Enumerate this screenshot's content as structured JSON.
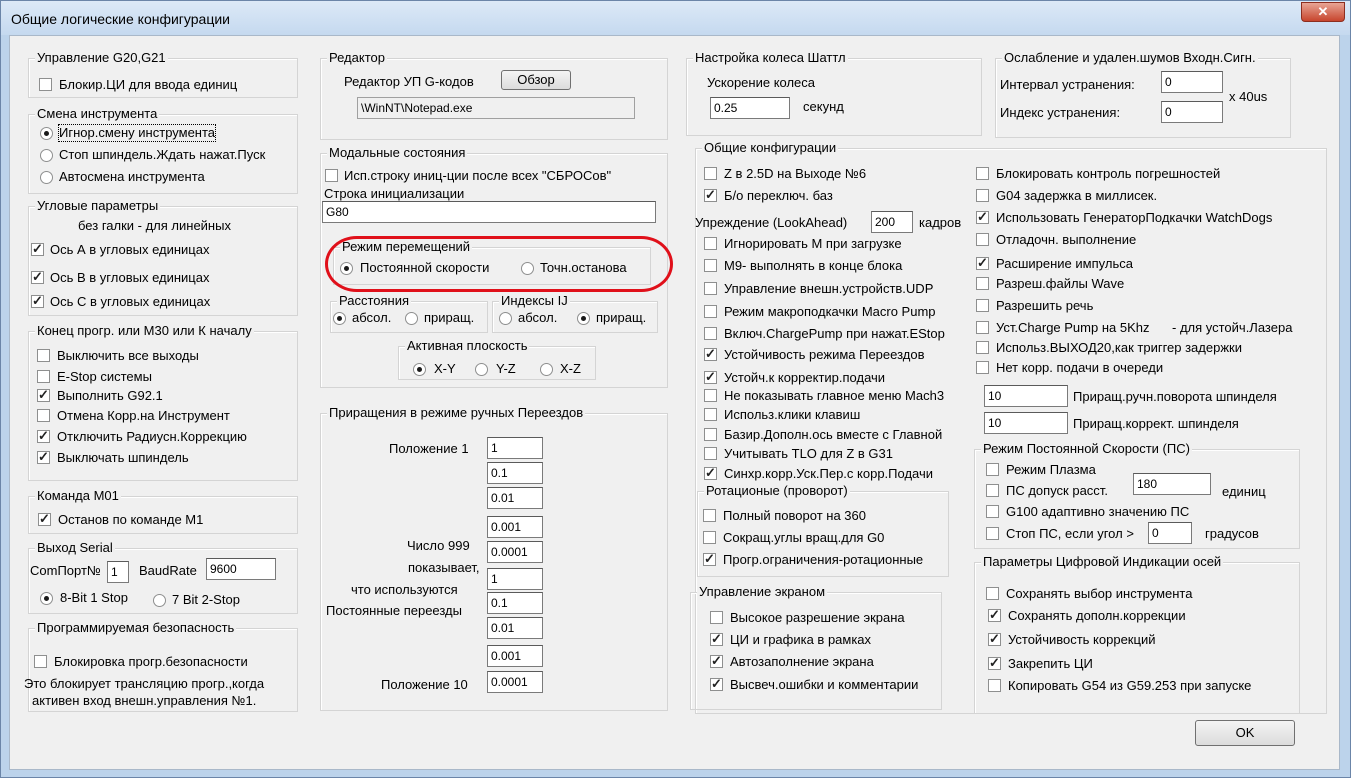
{
  "title": "Общие логические конфигурации",
  "close_label": "✕",
  "g20": {
    "title": "Управление G20,G21",
    "items": [
      "Блокир.ЦИ для ввода единиц"
    ]
  },
  "tool": {
    "title": "Смена инструмента",
    "items": [
      "Игнор.смену инструмента",
      "Стоп шпиндель.Ждать нажат.Пуск",
      "Автосмена инструмента"
    ]
  },
  "angular": {
    "title": "Угловые параметры",
    "subtitle": "без галки - для линейных",
    "items": [
      "Ось А в угловых единицах",
      "Ось B в угловых единицах",
      "Ось C в угловых единицах"
    ]
  },
  "endprog": {
    "title": "Конец прогр. или М30 или К началу",
    "items": [
      "Выключить все выходы",
      "E-Stop системы",
      "Выполнить G92.1",
      "Отмена Корр.на Инструмент",
      "Отключить Радиусн.Коррекцию",
      "Выключать шпиндель"
    ]
  },
  "m01": {
    "title": "Команда М01",
    "items": [
      "Останов по команде М1"
    ]
  },
  "serial": {
    "title": "Выход Serial",
    "port_label": "ComПорт№",
    "port_value": "1",
    "baud_label": "BaudRate",
    "baud_value": "9600",
    "opt1": "8-Bit 1 Stop",
    "opt2": "7 Bit 2-Stop"
  },
  "safety": {
    "title": "Программируемая безопасность",
    "item": "Блокировка прогр.безопасности",
    "note1": "Это блокирует трансляцию прогр.,когда",
    "note2": "активен вход внешн.управления №1."
  },
  "editor": {
    "title": "Редактор",
    "label": "Редактор УП G-кодов",
    "browse": "Обзор",
    "path": "\\WinNT\\Notepad.exe"
  },
  "modal": {
    "title": "Модальные состояния",
    "reinit": "Исп.строку иниц-ции после всех \"СБРОСов\"",
    "init_label": "Строка инициализации",
    "init_value": "G80",
    "motion_title": "Режим перемещений",
    "motion_opt1": "Постоянной скорости",
    "motion_opt2": "Точн.останова",
    "dist_title": "Расстояния",
    "dist_opt1": "абсол.",
    "dist_opt2": "приращ.",
    "ij_title": "Индексы IJ",
    "ij_opt1": "абсол.",
    "ij_opt2": "приращ.",
    "plane_title": "Активная плоскость",
    "plane_opts": [
      "X-Y",
      "Y-Z",
      "X-Z"
    ]
  },
  "jog": {
    "title": "Приращения в режиме ручных Переездов",
    "pos1": "Положение 1",
    "pos10": "Положение 10",
    "note1": "Число 999",
    "note2": "показывает,",
    "note3": "что используются",
    "note4": "Постоянные переезды",
    "values": [
      "1",
      "0.1",
      "0.01",
      "0.001",
      "0.0001",
      "1",
      "0.1",
      "0.01",
      "0.001",
      "0.0001"
    ]
  },
  "shuttle": {
    "title": "Настройка колеса Шаттл",
    "label": "Ускорение колеса",
    "value": "0.25",
    "unit": "секунд"
  },
  "debounce": {
    "title": "Ослабление и удален.шумов Входн.Сигн.",
    "interval_label": "Интервал устранения:",
    "interval_value": "0",
    "index_label": "Индекс устранения:",
    "index_value": "0",
    "unit": "x 40us"
  },
  "general": {
    "title": "Общие конфигурации",
    "left_a": [
      "Z в 2.5D на Выходе №6",
      "Б/о переключ. баз"
    ],
    "lookahead_label": "Упреждение (LookAhead)",
    "lookahead_value": "200",
    "lookahead_unit": "кадров",
    "left_b": [
      "Игнорировать M при загрузке",
      "M9- выполнять в конце блока",
      "Управление внешн.устройств.UDP",
      "Режим макроподкачки Macro Pump",
      "Включ.ChargePump при нажат.EStop",
      "Устойчивость режима Переездов",
      "Устойч.к корректир.подачи",
      "Не показывать главное меню Mach3",
      "Использ.клики клавиш",
      "Базир.Дополн.ось вместе с Главной",
      "Учитывать TLO для Z в G31",
      "Синхр.корр.Уск.Пер.с корр.Подачи"
    ],
    "right": [
      "Блокировать контроль погрешностей",
      "G04 задержка в миллисек.",
      "Использовать ГенераторПодкачки WatchDogs",
      "Отладочн. выполнение",
      "Расширение импульса",
      "Разреш.файлы Wave",
      "Разрешить речь",
      "Уст.Charge Pump на 5Khz",
      "Использ.ВЫХОД20,как триггер задержки",
      "Нет корр. подачи в очереди"
    ],
    "laser_note": "- для устойч.Лазера",
    "spindle_inc_value": "10",
    "spindle_inc_label": "Приращ.ручн.поворота шпинделя",
    "spindle_corr_value": "10",
    "spindle_corr_label": "Приращ.коррект. шпинделя"
  },
  "rotary": {
    "title": "Ротационые (проворот)",
    "items": [
      "Полный поворот на 360",
      "Сокращ.углы вращ.для G0",
      "Прогр.ограничения-ротационные"
    ]
  },
  "screen": {
    "title": "Управление экраном",
    "items": [
      "Высокое разрешение экрана",
      "ЦИ и графика в рамках",
      "Автозаполнение экрана",
      "Высвеч.ошибки и комментарии"
    ]
  },
  "cv": {
    "title": "Режим Постоянной Скорости (ПС)",
    "plasma": "Режим Плазма",
    "tol_label": "ПС допуск расст.",
    "tol_value": "180",
    "tol_unit": "единиц",
    "g100": "G100 адаптивно значению ПС",
    "stop_label": "Стоп ПС, если угол >",
    "stop_value": "0",
    "stop_unit": "градусов"
  },
  "dro": {
    "title": "Параметры Цифровой Индикации осей",
    "items": [
      "Сохранять выбор инструмента",
      "Сохранять дополн.коррекции",
      "Устойчивость коррекций",
      "Закрепить ЦИ",
      "Копировать G54 из G59.253 при запуске"
    ]
  },
  "ok": "OK"
}
